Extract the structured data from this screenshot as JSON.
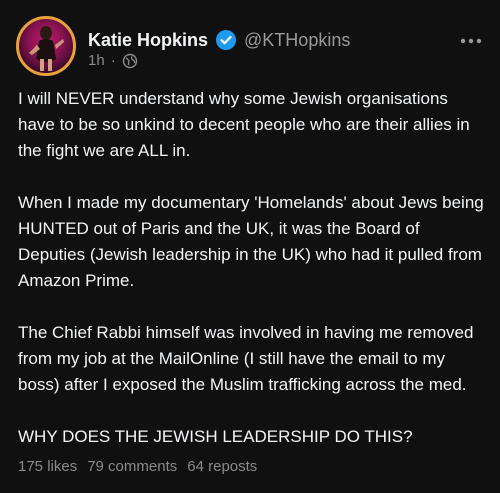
{
  "author": {
    "display_name": "Katie Hopkins",
    "handle": "@KTHopkins",
    "verified_icon": "verified-badge-icon",
    "badge_color": "#1d9bf0"
  },
  "meta": {
    "time": "1h",
    "separator": "·",
    "visibility_icon": "globe-icon"
  },
  "post": {
    "paragraphs": [
      "I will NEVER understand why some Jewish organisations have to be so unkind to decent people who are their allies in the fight we are ALL in.",
      "When I made my documentary 'Homelands' about Jews being HUNTED out of Paris and the UK, it was the Board of Deputies (Jewish leadership in the UK) who had it pulled from Amazon Prime.",
      "The Chief Rabbi himself was involved in having me removed from my job at the MailOnline (I still have the email to my boss) after I exposed the Muslim trafficking across the med.",
      "WHY DOES THE JEWISH LEADERSHIP DO THIS?"
    ]
  },
  "stats": {
    "likes": "175 likes",
    "comments": "79 comments",
    "reposts": "64 reposts"
  },
  "menu_icon": "more-options-icon"
}
